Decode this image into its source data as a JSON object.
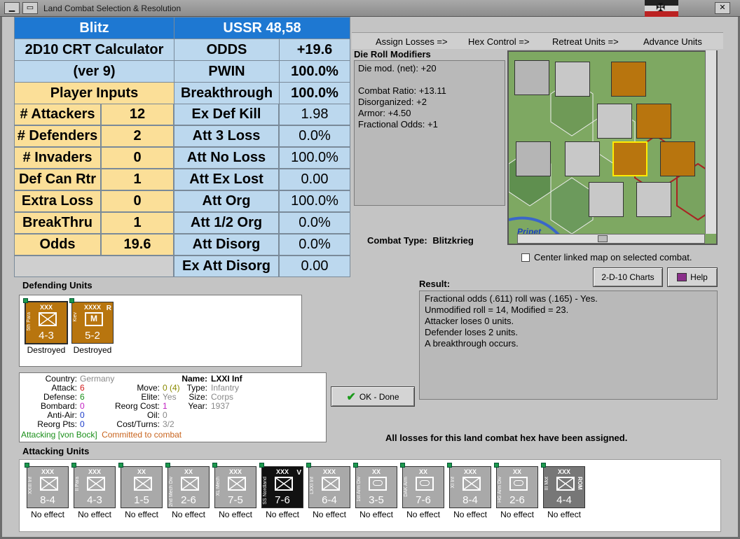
{
  "window": {
    "title": "Land Combat Selection & Resolution"
  },
  "crt": {
    "left_title": "Blitz",
    "right_title": "USSR 48,58",
    "calc_title": "2D10 CRT Calculator",
    "calc_version": "(ver 9)",
    "player_inputs": "Player Inputs",
    "inputs": [
      {
        "label": "# Attackers",
        "value": "12"
      },
      {
        "label": "# Defenders",
        "value": "2"
      },
      {
        "label": "# Invaders",
        "value": "0"
      },
      {
        "label": "Def Can Rtr",
        "value": "1"
      },
      {
        "label": "Extra Loss",
        "value": "0"
      },
      {
        "label": "BreakThru",
        "value": "1"
      },
      {
        "label": "Odds",
        "value": "19.6"
      }
    ],
    "results": [
      {
        "label": "ODDS",
        "value": "+19.6"
      },
      {
        "label": "PWIN",
        "value": "100.0%"
      },
      {
        "label": "Breakthrough",
        "value": "100.0%"
      },
      {
        "label": "Ex Def Kill",
        "value": "1.98"
      },
      {
        "label": "Att 3 Loss",
        "value": "0.0%"
      },
      {
        "label": "Att No Loss",
        "value": "100.0%"
      },
      {
        "label": "Att Ex Lost",
        "value": "0.00"
      },
      {
        "label": "Att Org",
        "value": "100.0%"
      },
      {
        "label": "Att 1/2 Org",
        "value": "0.0%"
      },
      {
        "label": "Att Disorg",
        "value": "0.0%"
      },
      {
        "label": "Ex Att Disorg",
        "value": "0.00"
      }
    ]
  },
  "phases": [
    "Assign Losses =>",
    "Hex Control =>",
    "Retreat Units =>",
    "Advance Units"
  ],
  "die_roll": {
    "title": "Die Roll Modifiers",
    "lines": [
      "Die mod. (net): +20",
      "",
      "Combat Ratio: +13.11",
      "Disorganized: +2",
      "Armor: +4.50",
      "Fractional Odds: +1"
    ]
  },
  "combat_type": {
    "label": "Combat Type:",
    "value": "Blitzkrieg"
  },
  "map": {
    "place_label": "Pripet",
    "center_checkbox": "Center linked map on selected combat."
  },
  "buttons": {
    "charts": "2-D-10 Charts",
    "help": "Help",
    "ok": "OK - Done"
  },
  "result": {
    "title": "Result:",
    "lines": [
      "Fractional odds (.611) roll was (.165)  - Yes.",
      "Unmodified roll = 14, Modified = 23.",
      "Attacker loses 0 units.",
      "Defender loses 2 units.",
      "A breakthrough occurs."
    ]
  },
  "defending": {
    "title": "Defending Units",
    "units": [
      {
        "size": "XXX",
        "name": "5th Para",
        "strength": "4-3",
        "status": "Destroyed",
        "color": "#b8750e",
        "symbol": "X"
      },
      {
        "size": "XXXX",
        "name": "Kiev",
        "strength": "5-2",
        "status": "Destroyed",
        "color": "#b8750e",
        "symbol": "M",
        "flag": "R"
      }
    ]
  },
  "unit_info": {
    "country_label": "Country:",
    "country": "Germany",
    "attack_label": "Attack:",
    "attack": "6",
    "defense_label": "Defense:",
    "defense": "6",
    "bombard_label": "Bombard:",
    "bombard": "0",
    "antiair_label": "Anti-Air:",
    "antiair": "0",
    "reorg_label": "Reorg Pts:",
    "reorg": "0",
    "name_label": "Name:",
    "name": "LXXI Inf",
    "move_label": "Move:",
    "move": "0 (4)",
    "type_label": "Type:",
    "type": "Infantry",
    "elite_label": "Elite:",
    "elite": "Yes",
    "size_label": "Size:",
    "size": "Corps",
    "reorgcost_label": "Reorg Cost:",
    "reorgcost": "1",
    "year_label": "Year:",
    "year": "1937",
    "oil_label": "Oil:",
    "oil": "0",
    "cost_label": "Cost/Turns:",
    "cost": "3/2",
    "attacking_note": "Attacking [von Bock]",
    "committed_note": "Committed to combat"
  },
  "losses_note": "All losses for this land combat hex have been assigned.",
  "attacking": {
    "title": "Attacking Units",
    "units": [
      {
        "size": "XXX",
        "name": "XXIII Inf",
        "strength": "8-4",
        "status": "No effect",
        "color": "#a9a9a9",
        "symbol": "X"
      },
      {
        "size": "XXX",
        "name": "II Para",
        "strength": "4-3",
        "status": "No effect",
        "color": "#a9a9a9",
        "symbol": "X"
      },
      {
        "size": "XX",
        "name": "",
        "strength": "1-5",
        "status": "No effect",
        "color": "#a9a9a9",
        "symbol": "X"
      },
      {
        "size": "XX",
        "name": "2nd Mech Div",
        "strength": "2-6",
        "status": "No effect",
        "color": "#a9a9a9",
        "symbol": "X"
      },
      {
        "size": "XXX",
        "name": "XL Mech",
        "strength": "7-5",
        "status": "No effect",
        "color": "#a9a9a9",
        "symbol": "X"
      },
      {
        "size": "XXX",
        "name": "SS Nordland",
        "strength": "7-6",
        "status": "No effect",
        "color": "#111111",
        "symbol": "X",
        "flag": "V"
      },
      {
        "size": "XXX",
        "name": "LXXI Inf",
        "strength": "6-4",
        "status": "No effect",
        "color": "#a9a9a9",
        "symbol": "X"
      },
      {
        "size": "XX",
        "name": "1st Arm Div",
        "strength": "3-5",
        "status": "No effect",
        "color": "#a9a9a9",
        "symbol": "O"
      },
      {
        "size": "XX",
        "name": "DAK Arm",
        "strength": "7-6",
        "status": "No effect",
        "color": "#a9a9a9",
        "symbol": "O"
      },
      {
        "size": "XXX",
        "name": "XI Inf",
        "strength": "8-4",
        "status": "No effect",
        "color": "#a9a9a9",
        "symbol": "X"
      },
      {
        "size": "XX",
        "name": "HG Arm Div",
        "strength": "2-6",
        "status": "No effect",
        "color": "#a9a9a9",
        "symbol": "O"
      },
      {
        "size": "XXX",
        "name": "III Mot",
        "strength": "4-4",
        "status": "No effect",
        "color": "#777777",
        "symbol": "X",
        "flag": "ROM"
      }
    ]
  }
}
